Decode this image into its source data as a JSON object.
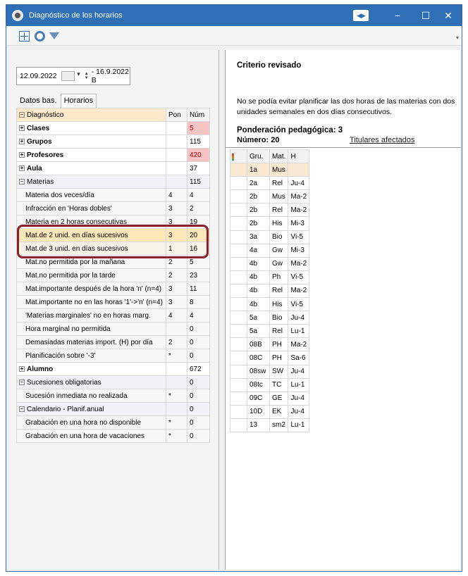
{
  "window": {
    "title": "Diagnóstico de los horarios",
    "controls": {
      "minimize": "−",
      "maximize": "☐",
      "close": "✕"
    }
  },
  "toolbar": {
    "icons": [
      "grid-icon",
      "settings-icon",
      "filter-icon"
    ]
  },
  "left": {
    "date_value": "12.09.2022",
    "date_range": "- 16.9.2022 B",
    "tabs": [
      {
        "label": "Datos bas."
      },
      {
        "label": "Horarios"
      }
    ],
    "table": {
      "headers": [
        "Diagnóstico",
        "Pon",
        "Núm"
      ],
      "rows": [
        {
          "label": "Clases",
          "pon": "",
          "num": "5",
          "type": "group",
          "exp": "+",
          "pink": true
        },
        {
          "label": "Grupos",
          "pon": "",
          "num": "115",
          "type": "group",
          "exp": "+"
        },
        {
          "label": "Profesores",
          "pon": "",
          "num": "420",
          "type": "group",
          "exp": "+",
          "pink": true
        },
        {
          "label": "Aula",
          "pon": "",
          "num": "37",
          "type": "group",
          "exp": "+"
        },
        {
          "label": "Materias",
          "pon": "",
          "num": "115",
          "type": "section",
          "exp": "−"
        },
        {
          "label": "Materia dos veces/día",
          "pon": "4",
          "num": "4",
          "type": "sub"
        },
        {
          "label": "Infracción en 'Horas dobles'",
          "pon": "3",
          "num": "2",
          "type": "sub"
        },
        {
          "label": "Materia en 2 horas consecutivas",
          "pon": "3",
          "num": "19",
          "type": "sub"
        },
        {
          "label": "Mat.de 2 unid. en días sucesivos",
          "pon": "3",
          "num": "20",
          "type": "hl"
        },
        {
          "label": "Mat.de 3 unid. en días sucesivos",
          "pon": "1",
          "num": "16",
          "type": "hl2"
        },
        {
          "label": "Mat.no permitida por la mañana",
          "pon": "2",
          "num": "5",
          "type": "sub"
        },
        {
          "label": "Mat.no permitida por la tarde",
          "pon": "2",
          "num": "23",
          "type": "sub"
        },
        {
          "label": "Mat.importante después de la hora 'n' (n=4)",
          "pon": "3",
          "num": "11",
          "type": "sub"
        },
        {
          "label": "Mat.importante no en las horas '1'->'n' (n=4)",
          "pon": "3",
          "num": "8",
          "type": "sub"
        },
        {
          "label": "'Materias marginales' no en horas marg.",
          "pon": "4",
          "num": "4",
          "type": "sub"
        },
        {
          "label": "Hora marginal no permitida",
          "pon": "",
          "num": "0",
          "type": "sub"
        },
        {
          "label": "Demasiadas materias import. (H) por día",
          "pon": "2",
          "num": "0",
          "type": "sub"
        },
        {
          "label": "Planificación sobre '-3'",
          "pon": "*",
          "num": "0",
          "type": "sub"
        },
        {
          "label": "Alumno",
          "pon": "",
          "num": "672",
          "type": "group",
          "exp": "+"
        },
        {
          "label": "Sucesiones obligatorias",
          "pon": "",
          "num": "0",
          "type": "section",
          "exp": "−"
        },
        {
          "label": "Sucesión inmediata no realizada",
          "pon": "*",
          "num": "0",
          "type": "sub"
        },
        {
          "label": "Calendario - Planif.anual",
          "pon": "",
          "num": "0",
          "type": "section",
          "exp": "−"
        },
        {
          "label": "Grabación en una hora no disponible",
          "pon": "*",
          "num": "0",
          "type": "sub"
        },
        {
          "label": "Grabación en una hora de vacaciones",
          "pon": "*",
          "num": "0",
          "type": "sub"
        }
      ]
    }
  },
  "right": {
    "heading": "Criterio revisado",
    "description": "No se podía evitar planificar las dos horas de las materias con dos unidades semanales en dos días consecutivos.",
    "ponderacion": "Ponderación pedagógica: 3",
    "numero": "Número: 20",
    "titulares_link": "Titulares afectados",
    "table": {
      "headers": [
        "Gru.",
        "Mat.",
        "H"
      ],
      "rows": [
        [
          "1a",
          "Mus",
          ""
        ],
        [
          "2a",
          "Rel",
          "Ju-4"
        ],
        [
          "2b",
          "Mus",
          "Ma-2"
        ],
        [
          "2b",
          "Rel",
          "Ma-2"
        ],
        [
          "2b",
          "His",
          "Mi-3"
        ],
        [
          "3a",
          "Bio",
          "Vi-5"
        ],
        [
          "4a",
          "Gw",
          "Mi-3"
        ],
        [
          "4b",
          "Gw",
          "Ma-2"
        ],
        [
          "4b",
          "Ph",
          "Vi-5"
        ],
        [
          "4b",
          "Rel",
          "Ma-2"
        ],
        [
          "4b",
          "His",
          "Vi-5"
        ],
        [
          "5a",
          "Bio",
          "Ju-4"
        ],
        [
          "5a",
          "Rel",
          "Lu-1"
        ],
        [
          "08B",
          "PH",
          "Ma-2"
        ],
        [
          "08C",
          "PH",
          "Sa-6"
        ],
        [
          "08sw",
          "SW",
          "Ju-4"
        ],
        [
          "08tc",
          "TC",
          "Lu-1"
        ],
        [
          "09C",
          "GE",
          "Ju-4"
        ],
        [
          "10D",
          "EK",
          "Ju-4"
        ],
        [
          "13",
          "sm2",
          "Lu-1"
        ]
      ]
    }
  }
}
